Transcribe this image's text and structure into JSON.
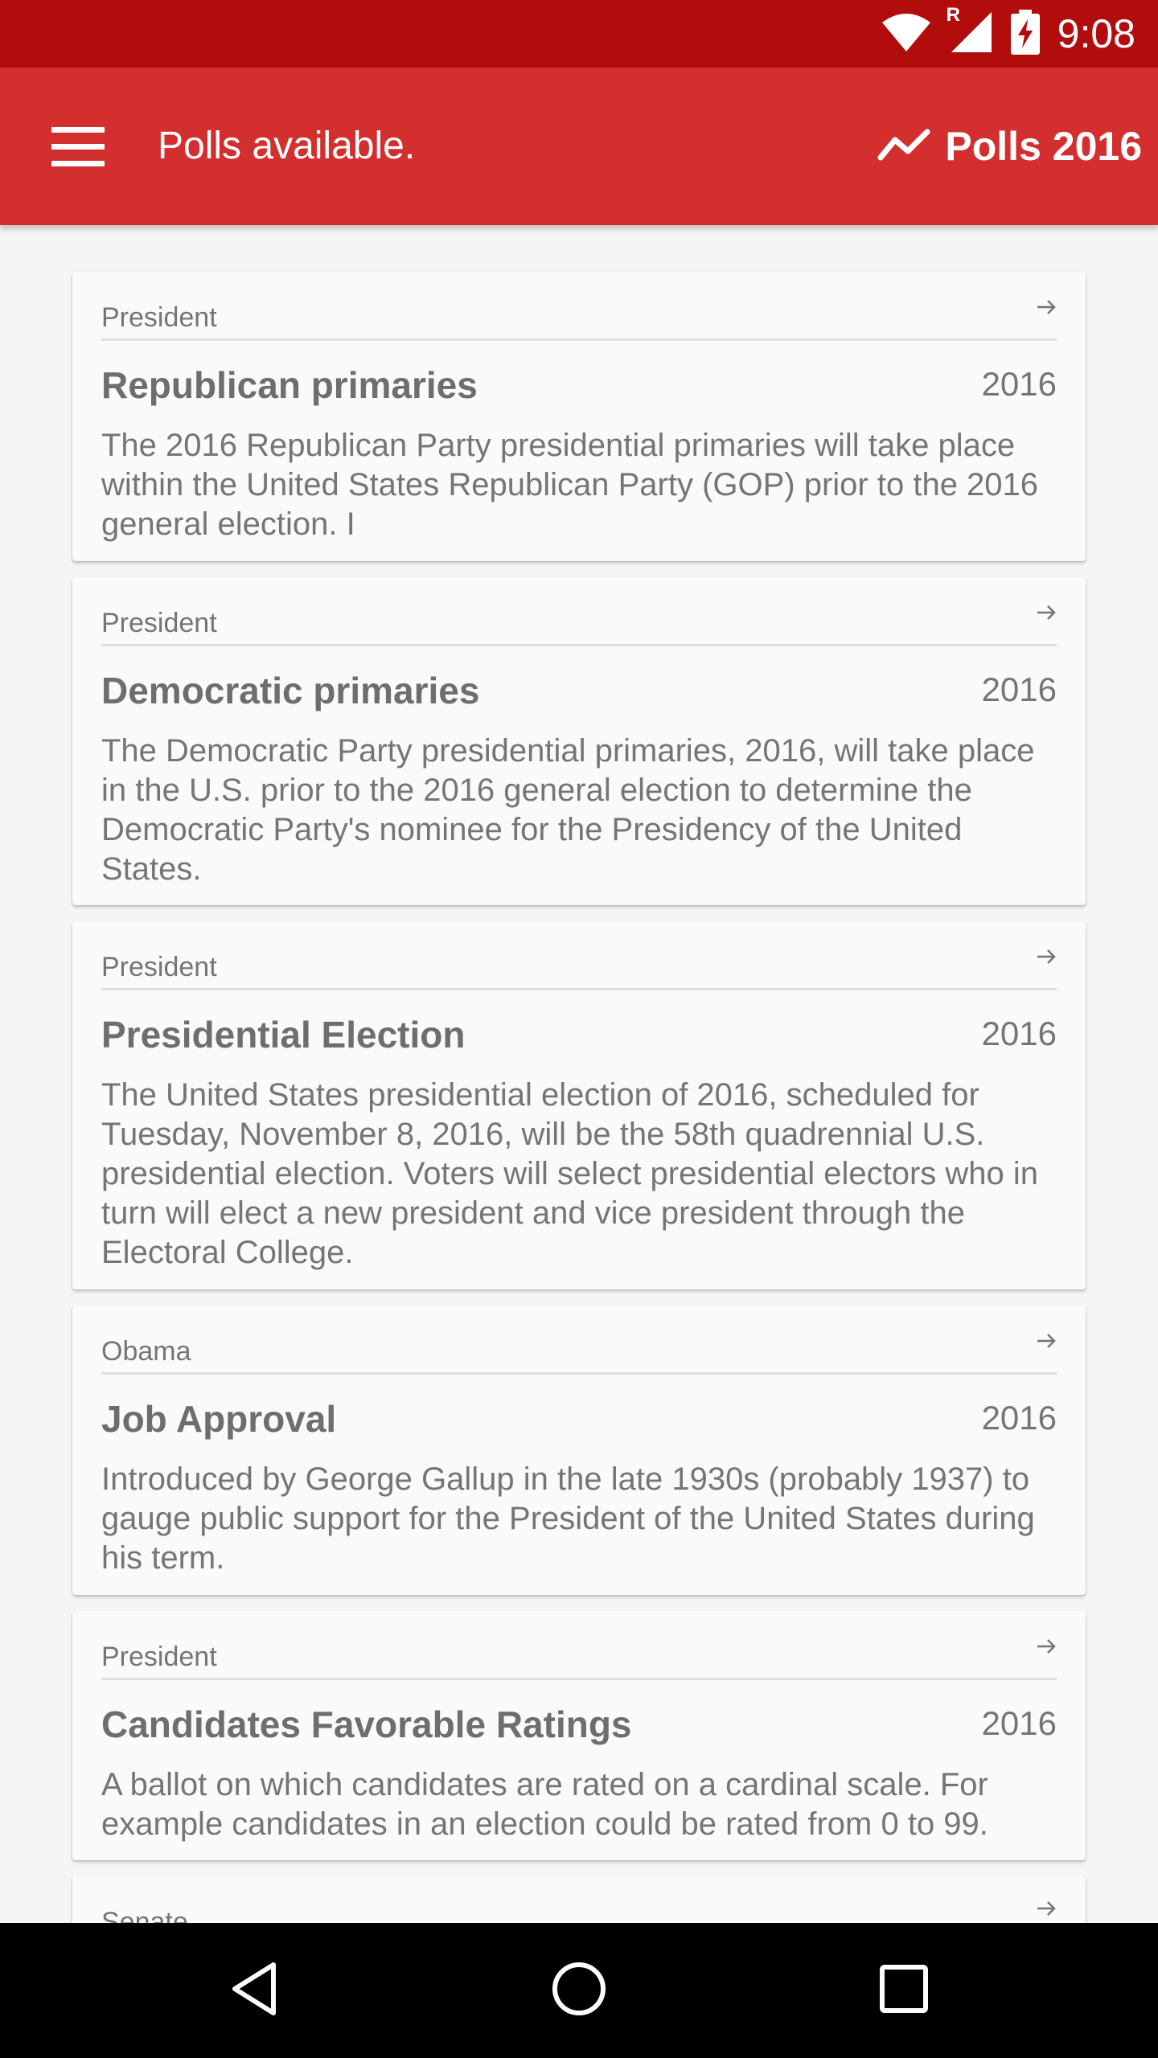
{
  "status_bar": {
    "time": "9:08",
    "icons": [
      "wifi-icon",
      "signal-icon",
      "battery-charging-icon"
    ],
    "roaming_label": "R"
  },
  "app_bar": {
    "title": "Polls available.",
    "action_label": "Polls 2016",
    "menu_icon": "hamburger-menu-icon",
    "action_icon": "trending-chart-icon",
    "color": "#d32f2f"
  },
  "polls": [
    {
      "category": "President",
      "title": "Republican primaries",
      "year": "2016",
      "description": "The 2016 Republican Party presidential primaries will take place within the United States Republican Party (GOP) prior to the 2016 general election. I"
    },
    {
      "category": "President",
      "title": "Democratic primaries",
      "year": "2016",
      "description": "The Democratic Party presidential primaries, 2016, will take place in the U.S. prior to the 2016 general election to determine the Democratic Party's nominee for the Presidency of the United States."
    },
    {
      "category": "President",
      "title": "Presidential Election",
      "year": "2016",
      "description": "The United States presidential election of 2016, scheduled for Tuesday, November 8, 2016, will be the 58th quadrennial U.S. presidential election. Voters will select presidential electors who in turn will elect a new president and vice president through the Electoral College."
    },
    {
      "category": "Obama",
      "title": "Job Approval",
      "year": "2016",
      "description": "Introduced by George Gallup in the late 1930s (probably 1937) to gauge public support for the President of the United States during his term."
    },
    {
      "category": "President",
      "title": "Candidates Favorable Ratings",
      "year": "2016",
      "description": "A ballot on which candidates are rated on a cardinal scale. For example candidates in an election could be rated from 0 to 99."
    },
    {
      "category": "Senate",
      "title": "",
      "year": "",
      "description": ""
    }
  ],
  "nav_bar": {
    "icons": [
      "back-icon",
      "home-icon",
      "recents-icon"
    ]
  }
}
